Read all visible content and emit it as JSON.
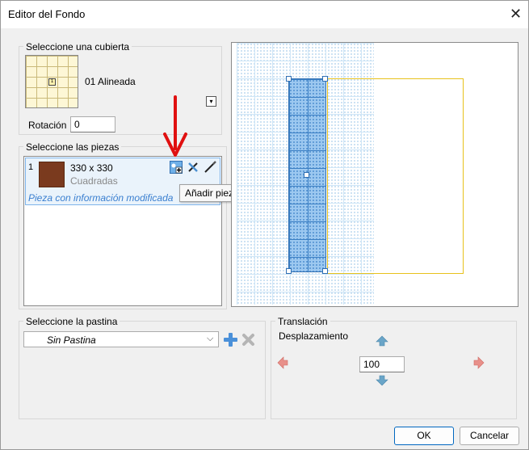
{
  "window": {
    "title": "Editor del Fondo"
  },
  "deck": {
    "legend": "Seleccione una cubierta",
    "name": "01 Alineada",
    "rotation_label": "Rotación",
    "rotation_value": "0"
  },
  "pieces": {
    "legend": "Seleccione las piezas",
    "items": [
      {
        "index": "1",
        "size": "330 x 330",
        "type": "Cuadradas",
        "note": "Pieza con información modificada"
      }
    ],
    "tooltip": "Añadir pieza a la biblioteca"
  },
  "grout": {
    "legend": "Seleccione la pastina",
    "selected": "Sin Pastina"
  },
  "translation": {
    "legend": "Translación",
    "label": "Desplazamiento",
    "value": "100"
  },
  "buttons": {
    "ok": "OK",
    "cancel": "Cancelar"
  },
  "colors": {
    "piece_fill": "#9cc8f0",
    "frame_yellow": "#e8c21c",
    "annotation_arrow": "#e01010",
    "tile_brown": "#7a3a1e"
  }
}
